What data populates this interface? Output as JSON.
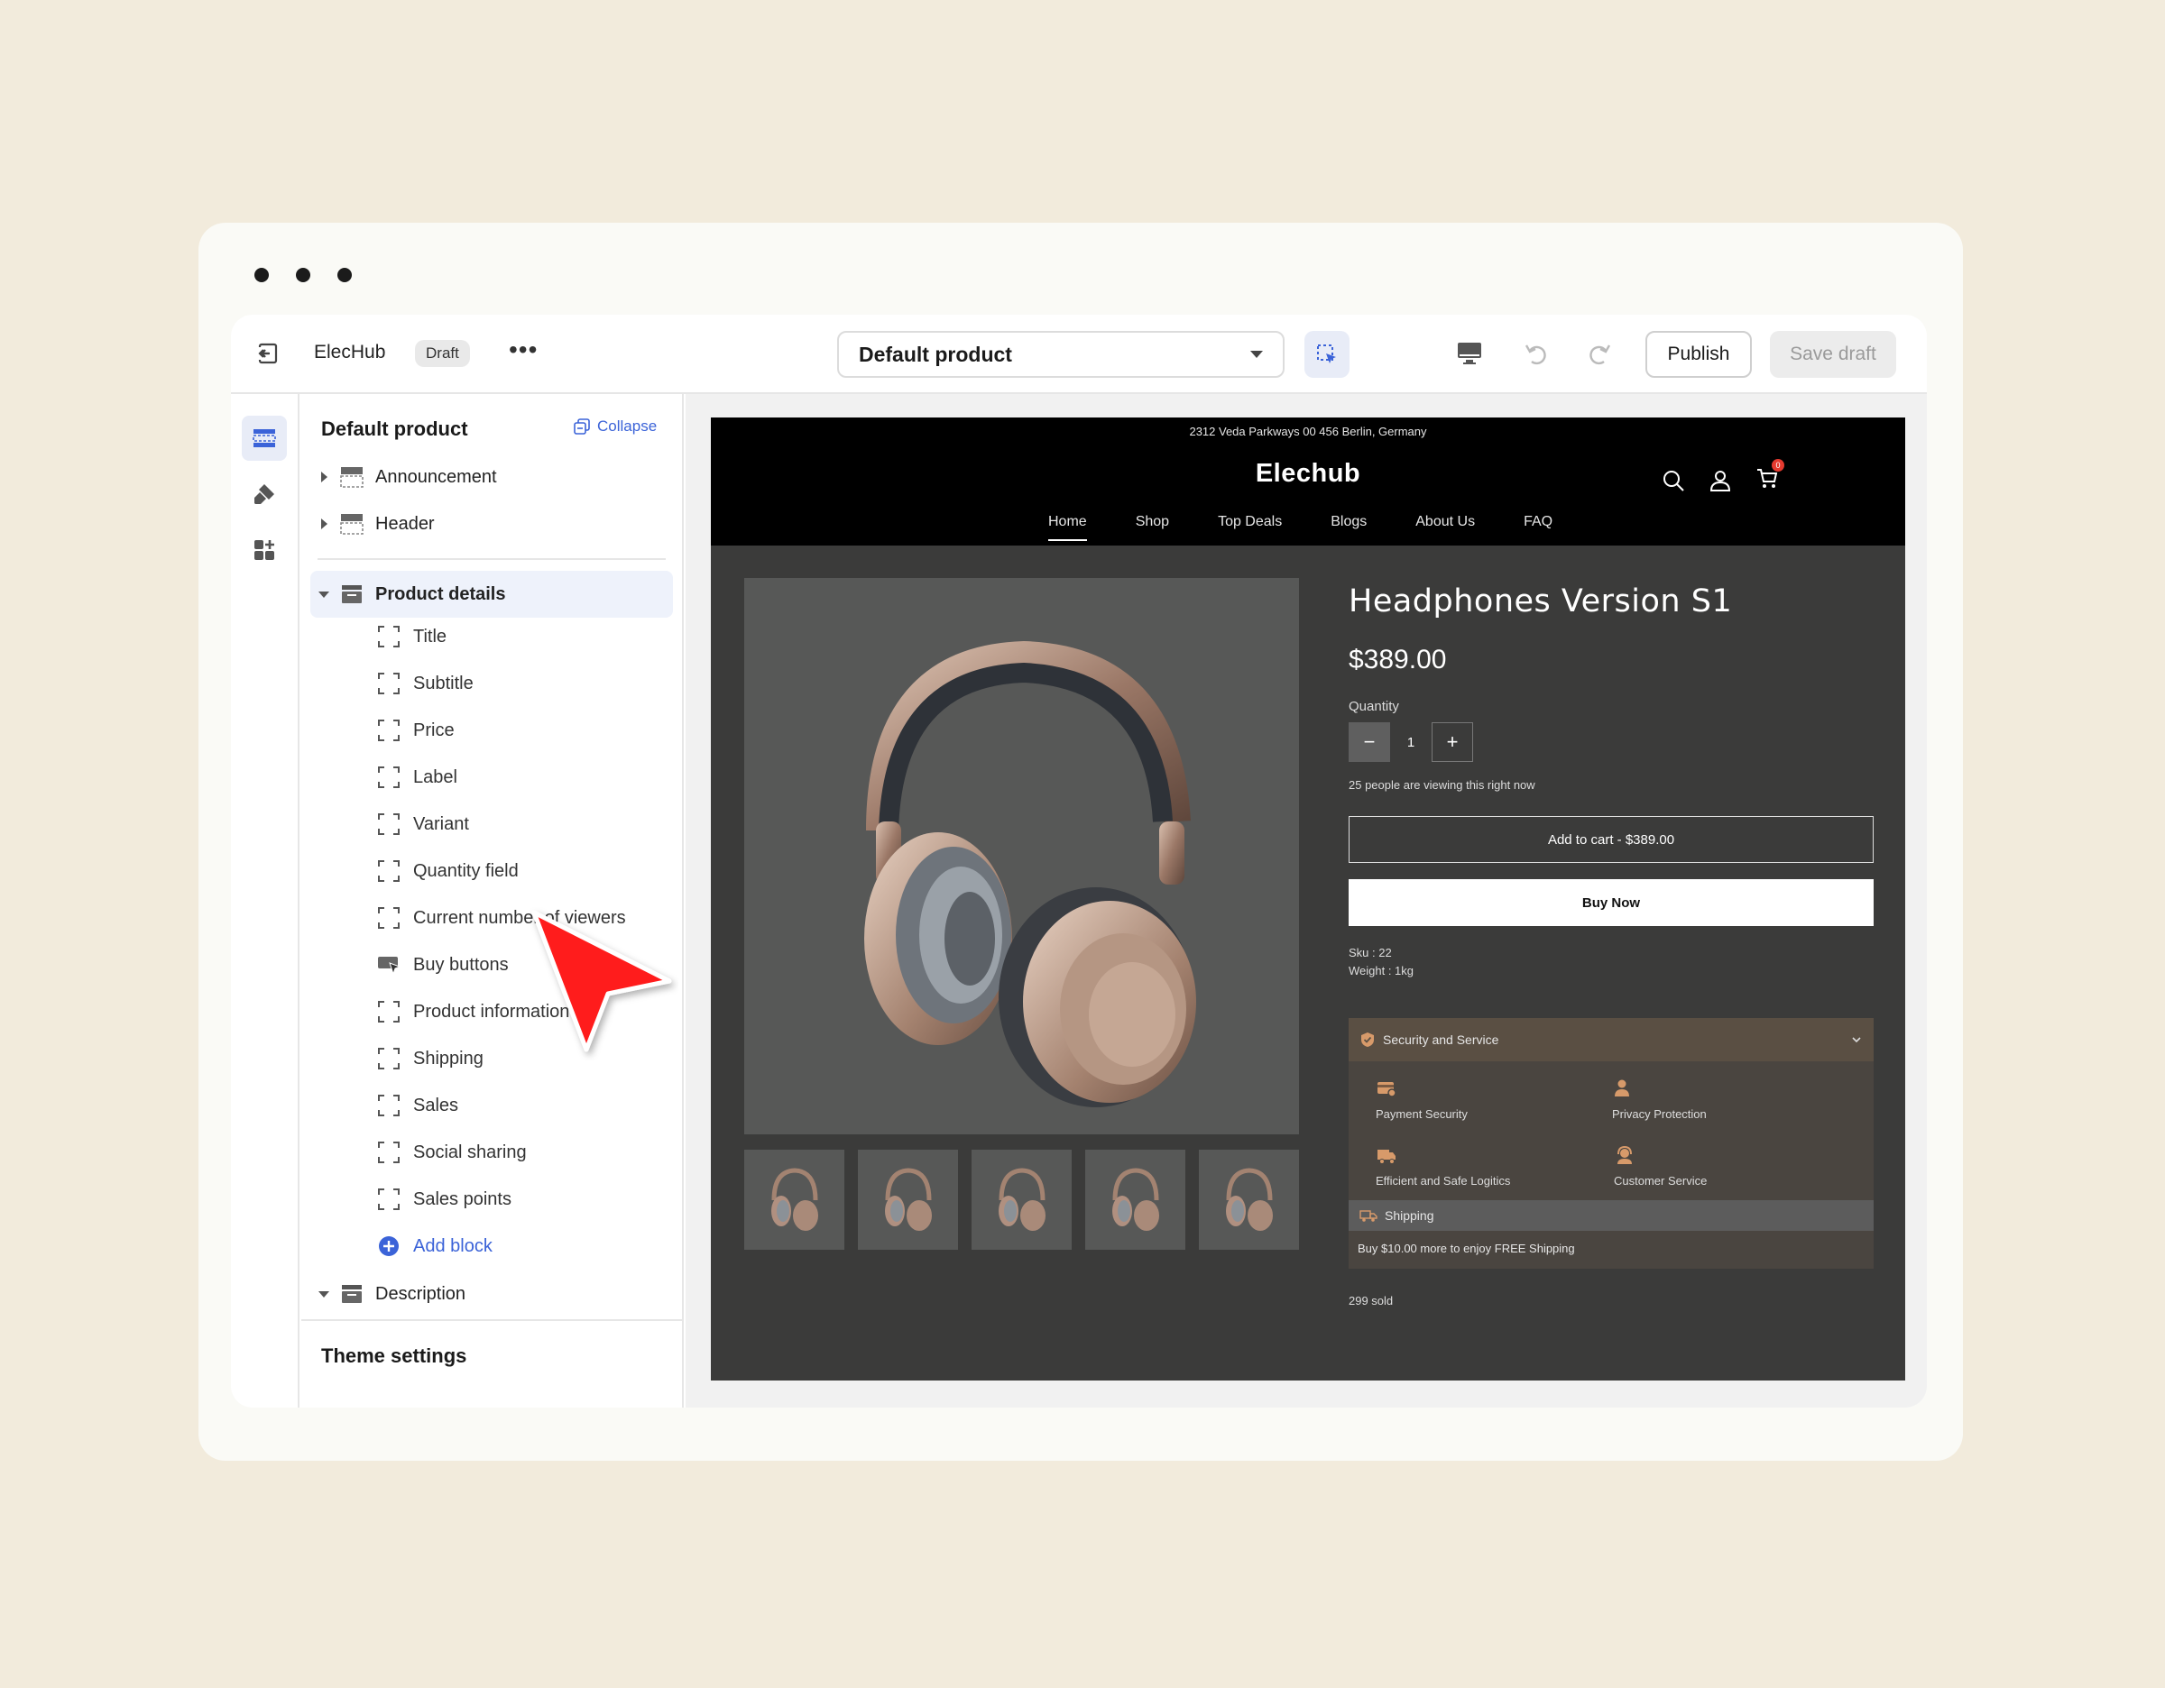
{
  "editor": {
    "store_name": "ElecHub",
    "status_badge": "Draft",
    "more_label": "•••",
    "template_select": "Default product",
    "publish_label": "Publish",
    "save_draft_label": "Save draft"
  },
  "sidebar": {
    "title": "Default product",
    "collapse_label": "Collapse",
    "sections": [
      {
        "label": "Announcement"
      },
      {
        "label": "Header"
      },
      {
        "label": "Product details"
      },
      {
        "label": "Description"
      }
    ],
    "blocks": [
      {
        "label": "Title"
      },
      {
        "label": "Subtitle"
      },
      {
        "label": "Price"
      },
      {
        "label": "Label"
      },
      {
        "label": "Variant"
      },
      {
        "label": "Quantity field"
      },
      {
        "label": "Current number of viewers"
      },
      {
        "label": "Buy buttons"
      },
      {
        "label": "Product information"
      },
      {
        "label": "Shipping"
      },
      {
        "label": "Sales"
      },
      {
        "label": "Social sharing"
      },
      {
        "label": "Sales points"
      }
    ],
    "add_block_label": "Add block",
    "theme_settings_label": "Theme settings"
  },
  "store": {
    "announcement": "2312 Veda Parkways 00 456 Berlin, Germany",
    "logo": "Elechub",
    "nav": [
      "Home",
      "Shop",
      "Top Deals",
      "Blogs",
      "About Us",
      "FAQ"
    ],
    "cart_count": "0"
  },
  "product": {
    "title": "Headphones Version S1",
    "price": "$389.00",
    "quantity_label": "Quantity",
    "quantity_value": "1",
    "viewers_text": "25 people are viewing this right now",
    "add_to_cart_label": "Add to cart - $389.00",
    "buy_now_label": "Buy Now",
    "sku": "Sku : 22",
    "weight": "Weight : 1kg",
    "security_title": "Security and Service",
    "security_features": [
      {
        "label": "Payment Security"
      },
      {
        "label": "Privacy Protection"
      },
      {
        "label": "Efficient and Safe Logitics"
      },
      {
        "label": "Customer Service"
      }
    ],
    "shipping_title": "Shipping",
    "shipping_text": "Buy $10.00 more to enjoy FREE Shipping",
    "sold_text": "299 sold"
  },
  "colors": {
    "accent": "#3b63d8",
    "pointer": "#ff1a1a",
    "store_dark": "#3b3b3a"
  }
}
